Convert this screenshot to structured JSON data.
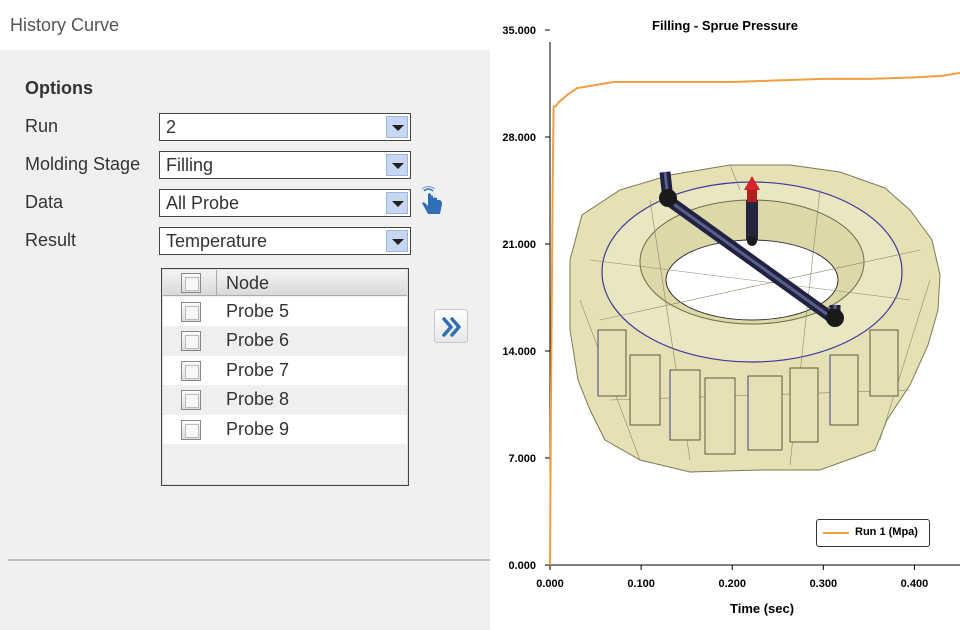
{
  "header": {
    "title": "History Curve"
  },
  "options": {
    "title": "Options",
    "run": {
      "label": "Run",
      "value": "2"
    },
    "molding_stage": {
      "label": "Molding Stage",
      "value": "Filling"
    },
    "data": {
      "label": "Data",
      "value": "All Probe"
    },
    "result": {
      "label": "Result",
      "value": "Temperature"
    }
  },
  "node_list": {
    "header": "Node",
    "items": [
      {
        "label": "Probe 5",
        "checked": false
      },
      {
        "label": "Probe 6",
        "checked": false
      },
      {
        "label": "Probe 7",
        "checked": false
      },
      {
        "label": "Probe 8",
        "checked": false
      },
      {
        "label": "Probe 9",
        "checked": false
      }
    ]
  },
  "icons": {
    "add": "double-chevron-right-icon",
    "pointer": "hand-pointer-icon"
  },
  "colors": {
    "series": "#f0a040",
    "accent": "#2f6fb5",
    "arrow_bg": "#c7d6f3"
  },
  "chart_data": {
    "type": "line",
    "title": "Filling - Sprue Pressure",
    "xlabel": "Time (sec)",
    "ylabel": "",
    "xlim": [
      0,
      0.45
    ],
    "ylim": [
      0,
      35
    ],
    "x_ticks": [
      "0.000",
      "0.100",
      "0.200",
      "0.300",
      "0.400"
    ],
    "y_ticks": [
      "0.000",
      "7.000",
      "14.000",
      "21.000",
      "28.000",
      "35.000"
    ],
    "legend": "bottom-right",
    "series": [
      {
        "name": "Run 1 (Mpa)",
        "color": "#f0a040",
        "x": [
          0.0,
          0.001,
          0.003,
          0.004,
          0.006,
          0.01,
          0.02,
          0.03,
          0.05,
          0.07,
          0.1,
          0.15,
          0.2,
          0.25,
          0.3,
          0.35,
          0.4,
          0.43,
          0.45
        ],
        "y": [
          0.0,
          10.0,
          25.0,
          30.0,
          30.0,
          30.3,
          30.8,
          31.2,
          31.4,
          31.6,
          31.6,
          31.6,
          31.6,
          31.7,
          31.8,
          31.8,
          31.9,
          32.0,
          32.2
        ]
      }
    ]
  }
}
